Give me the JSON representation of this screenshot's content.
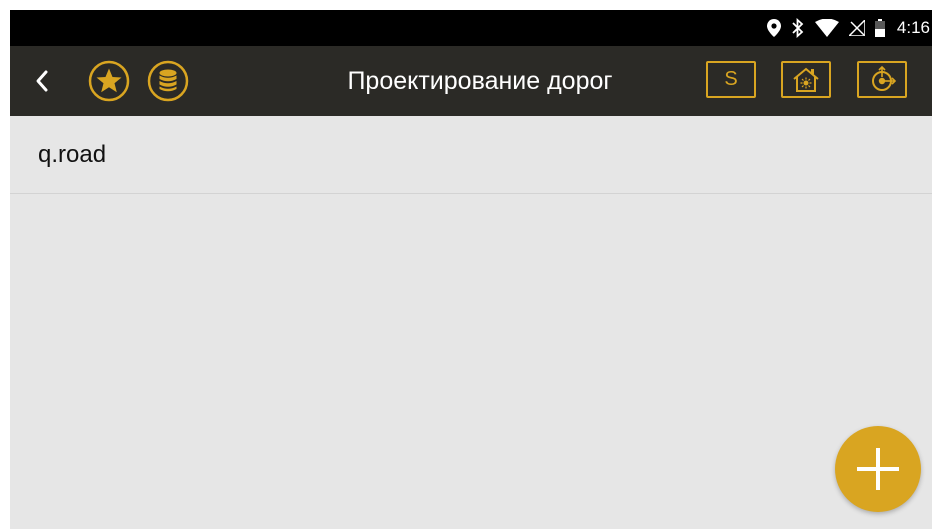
{
  "status_bar": {
    "time": "4:16",
    "icons": [
      "location-icon",
      "bluetooth-icon",
      "wifi-icon",
      "no-sim-icon",
      "battery-icon"
    ]
  },
  "app_bar": {
    "title": "Проектирование дорог",
    "back_icon": "back-arrow-icon",
    "favorite_icon": "star-icon",
    "database_icon": "database-icon",
    "s_button_label": "S",
    "home_icon": "home-icon",
    "target_icon": "target-icon"
  },
  "list": {
    "items": [
      {
        "label": "q.road"
      }
    ]
  },
  "fab": {
    "icon": "plus-icon"
  },
  "colors": {
    "accent": "#d9a521",
    "app_bar_bg": "#2b2a26",
    "status_bar_bg": "#000000",
    "content_bg": "#e6e6e6"
  }
}
